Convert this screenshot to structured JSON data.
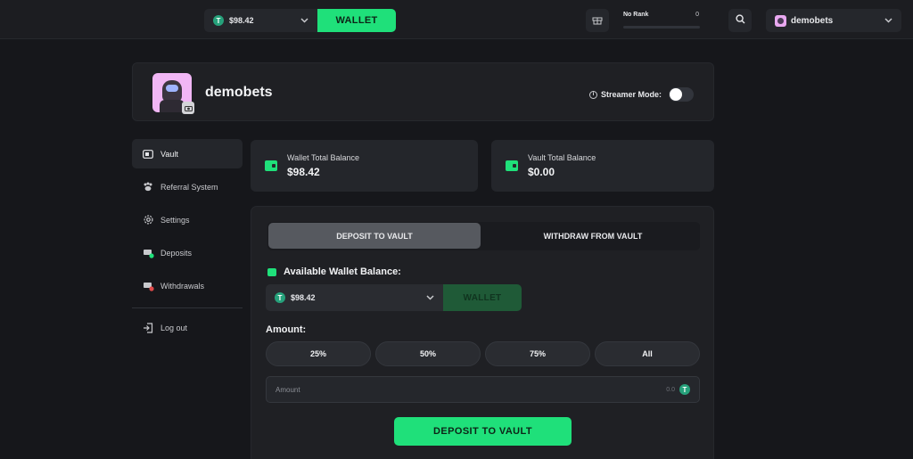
{
  "topbar": {
    "balance": "$98.42",
    "currency_icon": "tether-icon",
    "wallet_label": "WALLET",
    "rank_label": "No Rank",
    "rank_value": "0",
    "rank_progress": 0,
    "username": "demobets"
  },
  "profile": {
    "username": "demobets",
    "streamer_label": "Streamer Mode:",
    "streamer_mode": false
  },
  "sidebar": {
    "items": [
      {
        "label": "Vault",
        "icon": "vault-icon",
        "active": true
      },
      {
        "label": "Referral System",
        "icon": "paw-icon"
      },
      {
        "label": "Settings",
        "icon": "gear-icon"
      },
      {
        "label": "Deposits",
        "icon": "deposit-icon"
      },
      {
        "label": "Withdrawals",
        "icon": "withdraw-icon"
      }
    ],
    "logout": "Log out"
  },
  "stats": {
    "wallet_label": "Wallet Total Balance",
    "wallet_value": "$98.42",
    "vault_label": "Vault Total Balance",
    "vault_value": "$0.00"
  },
  "vault": {
    "tabs": [
      "DEPOSIT TO VAULT",
      "WITHDRAW FROM VAULT"
    ],
    "available_label": "Available Wallet Balance:",
    "select_value": "$98.42",
    "wallet_button": "WALLET",
    "amount_label": "Amount:",
    "percent_buttons": [
      "25%",
      "50%",
      "75%",
      "All"
    ],
    "amount_placeholder": "Amount",
    "amount_unit": "0.0",
    "deposit_button": "DEPOSIT TO VAULT"
  },
  "colors": {
    "accent": "#1fe07a",
    "background": "#16171b",
    "card": "#24262b"
  }
}
